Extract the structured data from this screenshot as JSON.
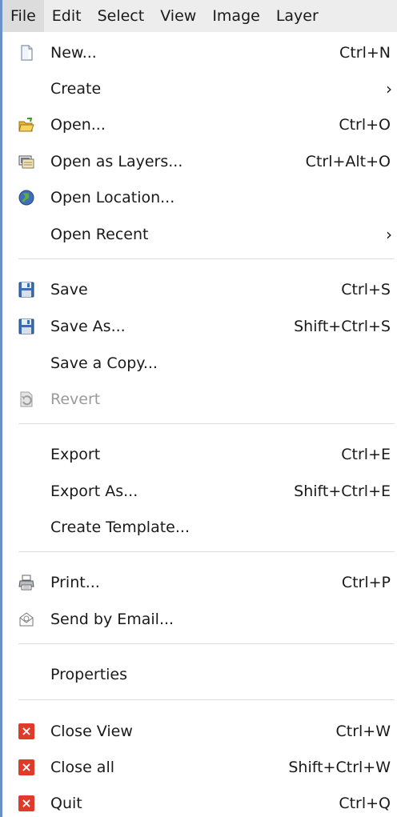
{
  "menubar": {
    "items": [
      "File",
      "Edit",
      "Select",
      "View",
      "Image",
      "Layer"
    ]
  },
  "file_menu": {
    "items": [
      {
        "label": "New...",
        "shortcut": "Ctrl+N",
        "icon": "new-document-icon"
      },
      {
        "label": "Create",
        "submenu": true
      },
      {
        "label": "Open...",
        "shortcut": "Ctrl+O",
        "icon": "open-folder-icon"
      },
      {
        "label": "Open as Layers...",
        "shortcut": "Ctrl+Alt+O",
        "icon": "open-layers-icon"
      },
      {
        "label": "Open Location...",
        "icon": "globe-icon"
      },
      {
        "label": "Open Recent",
        "submenu": true
      },
      {
        "label": "Save",
        "shortcut": "Ctrl+S",
        "icon": "floppy-disk-icon"
      },
      {
        "label": "Save As...",
        "shortcut": "Shift+Ctrl+S",
        "icon": "floppy-disk-icon"
      },
      {
        "label": "Save a Copy..."
      },
      {
        "label": "Revert",
        "icon": "revert-icon",
        "disabled": true
      },
      {
        "label": "Export",
        "shortcut": "Ctrl+E"
      },
      {
        "label": "Export As...",
        "shortcut": "Shift+Ctrl+E"
      },
      {
        "label": "Create Template..."
      },
      {
        "label": "Print...",
        "shortcut": "Ctrl+P",
        "icon": "printer-icon"
      },
      {
        "label": "Send by Email...",
        "icon": "email-icon"
      },
      {
        "label": "Properties"
      },
      {
        "label": "Close View",
        "shortcut": "Ctrl+W",
        "icon": "close-x-icon"
      },
      {
        "label": "Close all",
        "shortcut": "Shift+Ctrl+W",
        "icon": "close-x-icon"
      },
      {
        "label": "Quit",
        "shortcut": "Ctrl+Q",
        "icon": "close-x-icon"
      }
    ]
  },
  "colors": {
    "accent_edge": "#6a8fcb",
    "close_red": "#e03b2a",
    "disabled_text": "#9a9a9a"
  }
}
